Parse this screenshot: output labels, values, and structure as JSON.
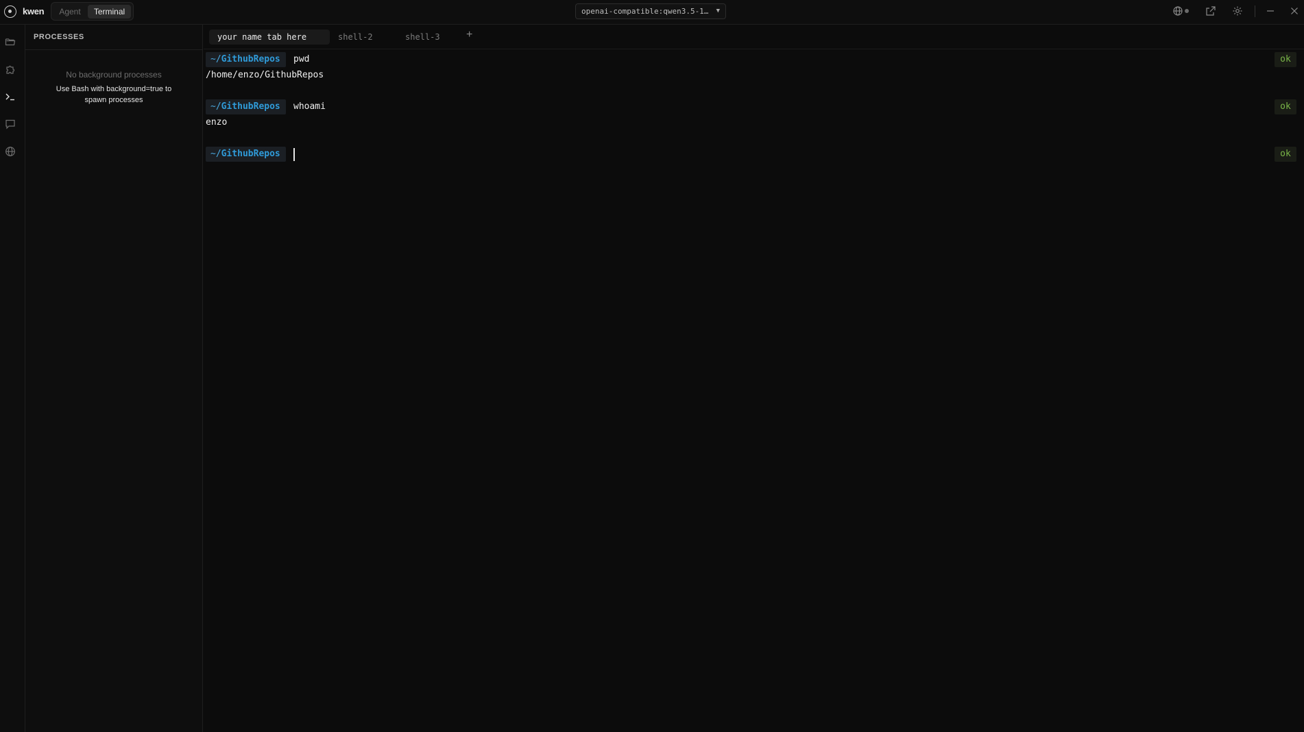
{
  "app": {
    "name": "kwen",
    "modes": [
      "Agent",
      "Terminal"
    ],
    "active_mode": "Terminal"
  },
  "model_select": {
    "value": "openai-compatible:qwen3.5-1…"
  },
  "processes": {
    "title": "PROCESSES",
    "empty_text": "No background processes",
    "hint_text": "Use Bash with background=true to spawn processes"
  },
  "tabs": [
    {
      "label": "your name tab here",
      "active": true
    },
    {
      "label": "shell-2",
      "active": false
    },
    {
      "label": "shell-3",
      "active": false
    }
  ],
  "tab_add_label": "+",
  "terminal": {
    "blocks": [
      {
        "cwd_prefix": "~/",
        "cwd_name": "GithubRepos",
        "command": "pwd",
        "output": "/home/enzo/GithubRepos",
        "status": "ok"
      },
      {
        "cwd_prefix": "~/",
        "cwd_name": "GithubRepos",
        "command": "whoami",
        "output": "enzo",
        "status": "ok"
      },
      {
        "cwd_prefix": "~/",
        "cwd_name": "GithubRepos",
        "command": "",
        "output": "",
        "status": "ok"
      }
    ]
  },
  "icons": {
    "activity": [
      "folder-icon",
      "puzzle-icon",
      "terminal-icon",
      "chat-icon",
      "globe-icon"
    ],
    "titlebar": [
      "globe-icon",
      "external-link-icon",
      "gear-icon",
      "minimize-icon",
      "close-icon"
    ]
  },
  "colors": {
    "background": "#0c0c0c",
    "prompt_path": "#2f9bd9",
    "status_ok": "#7ab648",
    "active_tab_bg": "#1a1a1a"
  }
}
